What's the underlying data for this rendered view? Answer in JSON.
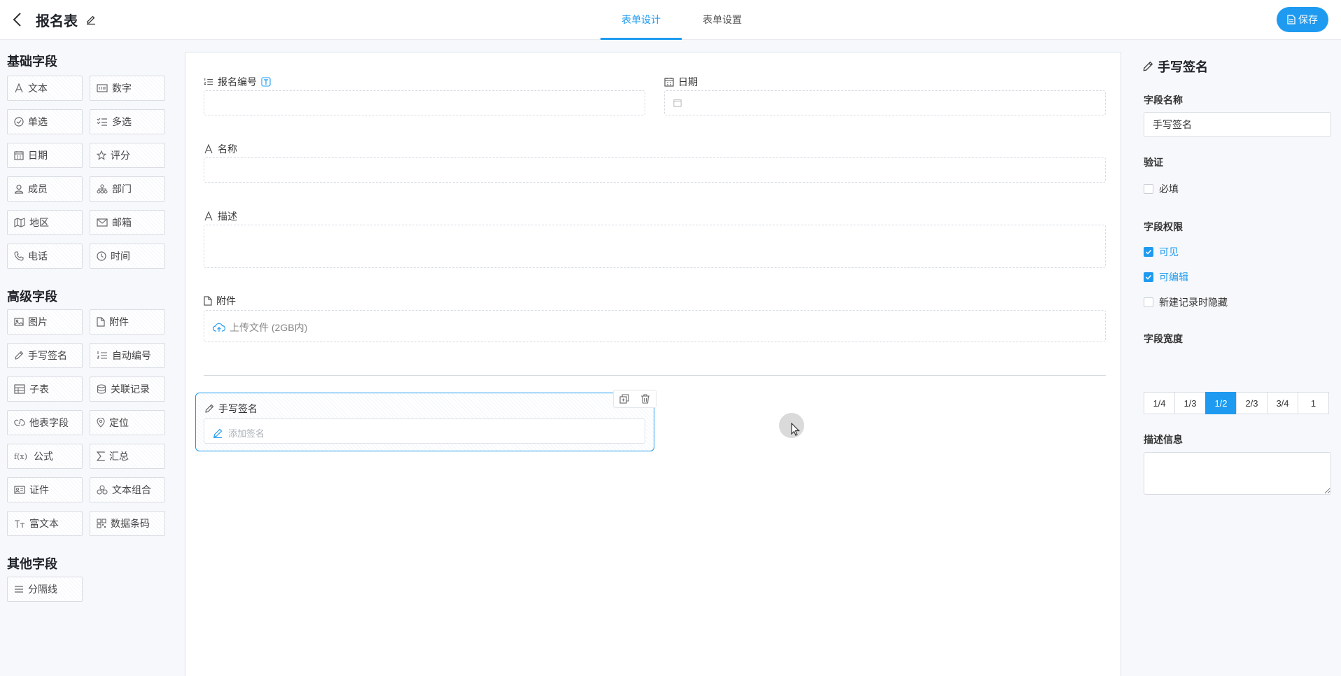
{
  "header": {
    "title": "报名表",
    "tabs": [
      {
        "label": "表单设计"
      },
      {
        "label": "表单设置"
      }
    ],
    "save_label": "保存"
  },
  "palette": {
    "basic_title": "基础字段",
    "basic_items": [
      "文本",
      "数字",
      "单选",
      "多选",
      "日期",
      "评分",
      "成员",
      "部门",
      "地区",
      "邮箱",
      "电话",
      "时间"
    ],
    "advanced_title": "高级字段",
    "advanced_items": [
      "图片",
      "附件",
      "手写签名",
      "自动编号",
      "子表",
      "关联记录",
      "他表字段",
      "定位",
      "公式",
      "汇总",
      "证件",
      "文本组合",
      "富文本",
      "数据条码"
    ],
    "other_title": "其他字段",
    "other_items": [
      "分隔线"
    ]
  },
  "canvas": {
    "fields": {
      "serial_label": "报名编号",
      "date_label": "日期",
      "name_label": "名称",
      "desc_label": "描述",
      "attach_label": "附件",
      "upload_text": "上传文件 (2GB内)"
    },
    "selected": {
      "label": "手写签名",
      "placeholder": "添加签名"
    }
  },
  "props": {
    "title": "手写签名",
    "field_name_label": "字段名称",
    "field_name_value": "手写签名",
    "validate_label": "验证",
    "required_label": "必填",
    "permission_label": "字段权限",
    "visible_label": "可见",
    "editable_label": "可编辑",
    "hide_on_new_label": "新建记录时隐藏",
    "width_label": "字段宽度",
    "width_options": [
      "1/4",
      "1/3",
      "1/2",
      "2/3",
      "3/4",
      "1"
    ],
    "description_label": "描述信息"
  },
  "colors": {
    "accent": "#1e9bf0"
  }
}
